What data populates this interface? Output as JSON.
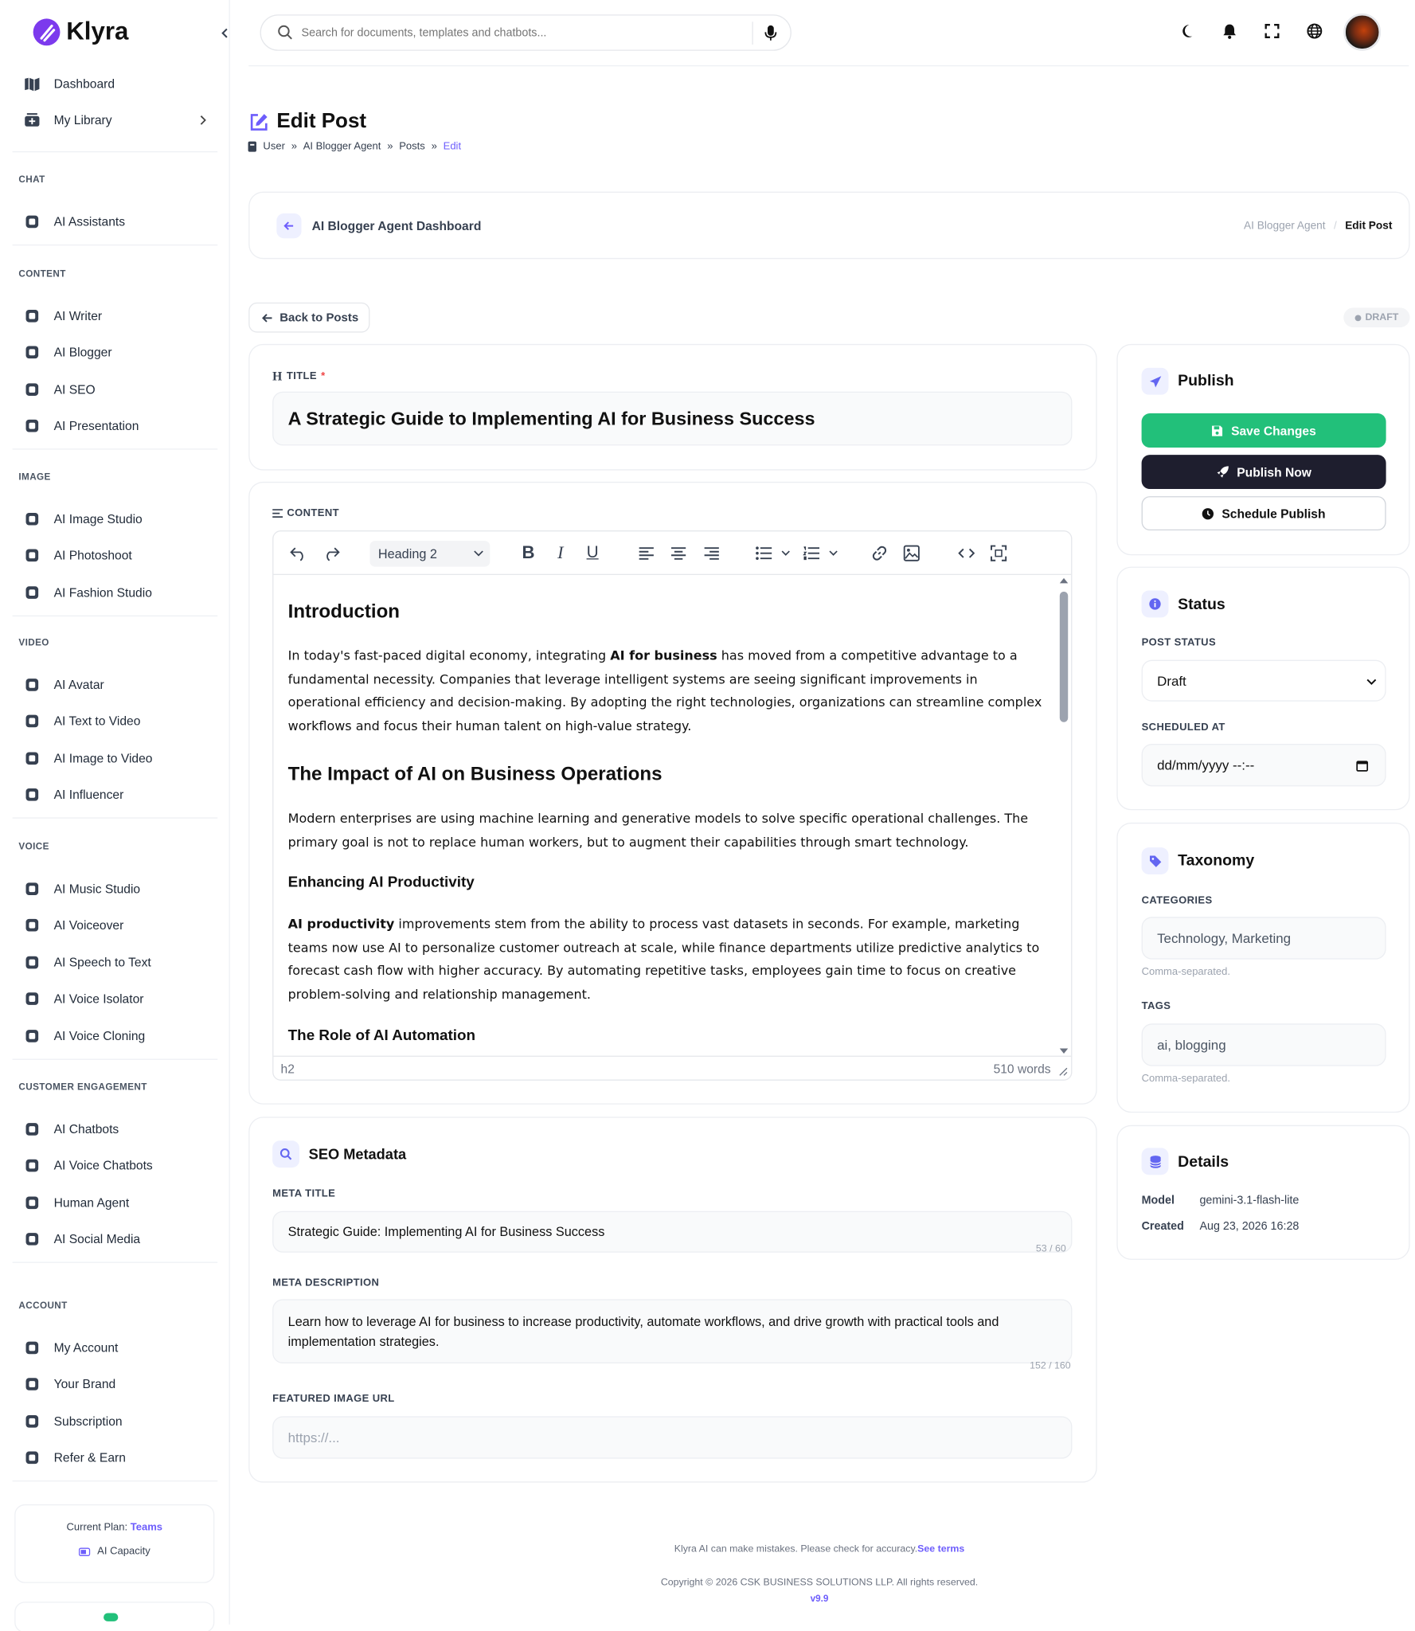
{
  "app": {
    "name": "Klyra"
  },
  "sidebar": {
    "top": [
      {
        "label": "Dashboard",
        "icon": "map-icon"
      },
      {
        "label": "My Library",
        "icon": "library-icon"
      }
    ],
    "sections": [
      {
        "title": "CHAT",
        "items": [
          "AI Assistants"
        ]
      },
      {
        "title": "CONTENT",
        "items": [
          "AI Writer",
          "AI Blogger",
          "AI SEO",
          "AI Presentation"
        ]
      },
      {
        "title": "IMAGE",
        "items": [
          "AI Image Studio",
          "AI Photoshoot",
          "AI Fashion Studio"
        ]
      },
      {
        "title": "VIDEO",
        "items": [
          "AI Avatar",
          "AI Text to Video",
          "AI Image to Video",
          "AI Influencer"
        ]
      },
      {
        "title": "VOICE",
        "items": [
          "AI Music Studio",
          "AI Voiceover",
          "AI Speech to Text",
          "AI Voice Isolator",
          "AI Voice Cloning"
        ]
      },
      {
        "title": "CUSTOMER ENGAGEMENT",
        "items": [
          "AI Chatbots",
          "AI Voice Chatbots",
          "Human Agent",
          "AI Social Media"
        ]
      },
      {
        "title": "ACCOUNT",
        "items": [
          "My Account",
          "Your Brand",
          "Subscription",
          "Refer & Earn"
        ]
      }
    ],
    "plan": {
      "prefix": "Current Plan: ",
      "name": "Teams",
      "capacity": "AI Capacity"
    }
  },
  "topbar": {
    "search_placeholder": "Search for documents, templates and chatbots..."
  },
  "page": {
    "title": "Edit Post",
    "breadcrumb": [
      "User",
      "AI Blogger Agent",
      "Posts",
      "Edit"
    ],
    "dashboard_link": "AI Blogger Agent Dashboard",
    "crumb_right": [
      "AI Blogger Agent",
      "Edit Post"
    ],
    "back": "Back to Posts",
    "status_badge": "DRAFT"
  },
  "editor": {
    "title_label": "TITLE",
    "title_value": "A Strategic Guide to Implementing AI for Business Success",
    "content_label": "CONTENT",
    "block_format": "Heading 2",
    "h_intro": "Introduction",
    "p1_a": "In today's fast-paced digital economy, integrating ",
    "p1_b": "AI for business",
    "p1_c": " has moved from a competitive advantage to a fundamental necessity. Companies that leverage intelligent systems are seeing significant improvements in operational efficiency and decision-making. By adopting the right technologies, organizations can streamline complex workflows and focus their human talent on high-value strategy.",
    "h_impact": "The Impact of AI on Business Operations",
    "p2": "Modern enterprises are using machine learning and generative models to solve specific operational challenges. The primary goal is not to replace human workers, but to augment their capabilities through smart technology.",
    "h_prod": "Enhancing AI Productivity",
    "p3_a": "AI productivity",
    "p3_b": " improvements stem from the ability to process vast datasets in seconds. For example, marketing teams now use AI to personalize customer outreach at scale, while finance departments utilize predictive analytics to forecast cash flow with higher accuracy. By automating repetitive tasks, employees gain time to focus on creative problem-solving and relationship management.",
    "h_auto": "The Role of AI Automation",
    "status_path": "h2",
    "word_count": "510 words"
  },
  "seo": {
    "title": "SEO Metadata",
    "meta_title_label": "META TITLE",
    "meta_title": "Strategic Guide: Implementing AI for Business Success",
    "meta_title_count": "53 / 60",
    "meta_desc_label": "META DESCRIPTION",
    "meta_desc": "Learn how to leverage AI for business to increase productivity, automate workflows, and drive growth with practical tools and implementation strategies.",
    "meta_desc_count": "152 / 160",
    "image_label": "FEATURED IMAGE URL",
    "image_placeholder": "https://..."
  },
  "publish": {
    "title": "Publish",
    "save": "Save Changes",
    "publish_now": "Publish Now",
    "schedule": "Schedule Publish"
  },
  "status": {
    "title": "Status",
    "post_status_label": "POST STATUS",
    "post_status": "Draft",
    "scheduled_label": "SCHEDULED AT",
    "scheduled_placeholder": "dd/mm/yyyy --:--"
  },
  "taxonomy": {
    "title": "Taxonomy",
    "categories_label": "CATEGORIES",
    "categories": "Technology, Marketing",
    "categories_hint": "Comma-separated.",
    "tags_label": "TAGS",
    "tags": "ai, blogging",
    "tags_hint": "Comma-separated."
  },
  "details": {
    "title": "Details",
    "model_label": "Model",
    "model": "gemini-3.1-flash-lite",
    "created_label": "Created",
    "created": "Aug 23, 2026 16:28"
  },
  "footer": {
    "disclaimer": "Klyra AI can make mistakes. Please check for accuracy.",
    "terms": "See terms",
    "copyright": "Copyright © 2026 CSK BUSINESS SOLUTIONS LLP. All rights reserved.",
    "version": "v9.9"
  },
  "colors": {
    "accent": "#6d5dfc",
    "green": "#22c07a",
    "dark": "#1e1e2e"
  }
}
